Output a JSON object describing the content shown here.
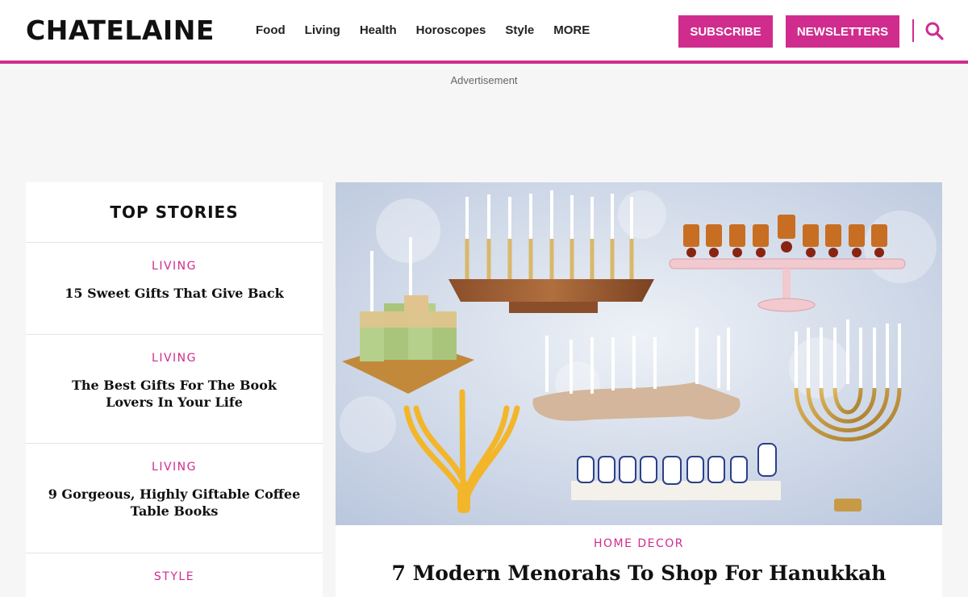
{
  "header": {
    "logo": "CHATELAINE",
    "nav": [
      "Food",
      "Living",
      "Health",
      "Horoscopes",
      "Style",
      "MORE"
    ],
    "subscribe_label": "SUBSCRIBE",
    "newsletters_label": "NEWSLETTERS",
    "search_icon": "search-icon"
  },
  "ad": {
    "label": "Advertisement"
  },
  "sidebar": {
    "title": "TOP STORIES",
    "stories": [
      {
        "category": "LIVING",
        "title": "15 Sweet Gifts That Give Back"
      },
      {
        "category": "LIVING",
        "title": "The Best Gifts For The Book Lovers In Your Life"
      },
      {
        "category": "LIVING",
        "title": "9 Gorgeous, Highly Giftable Coffee Table Books"
      },
      {
        "category": "STYLE",
        "title": ""
      }
    ]
  },
  "feature": {
    "category": "HOME DECOR",
    "title": "7 Modern Menorahs To Shop For Hanukkah"
  },
  "colors": {
    "accent": "#d02c8e",
    "background": "#f6f6f6"
  }
}
